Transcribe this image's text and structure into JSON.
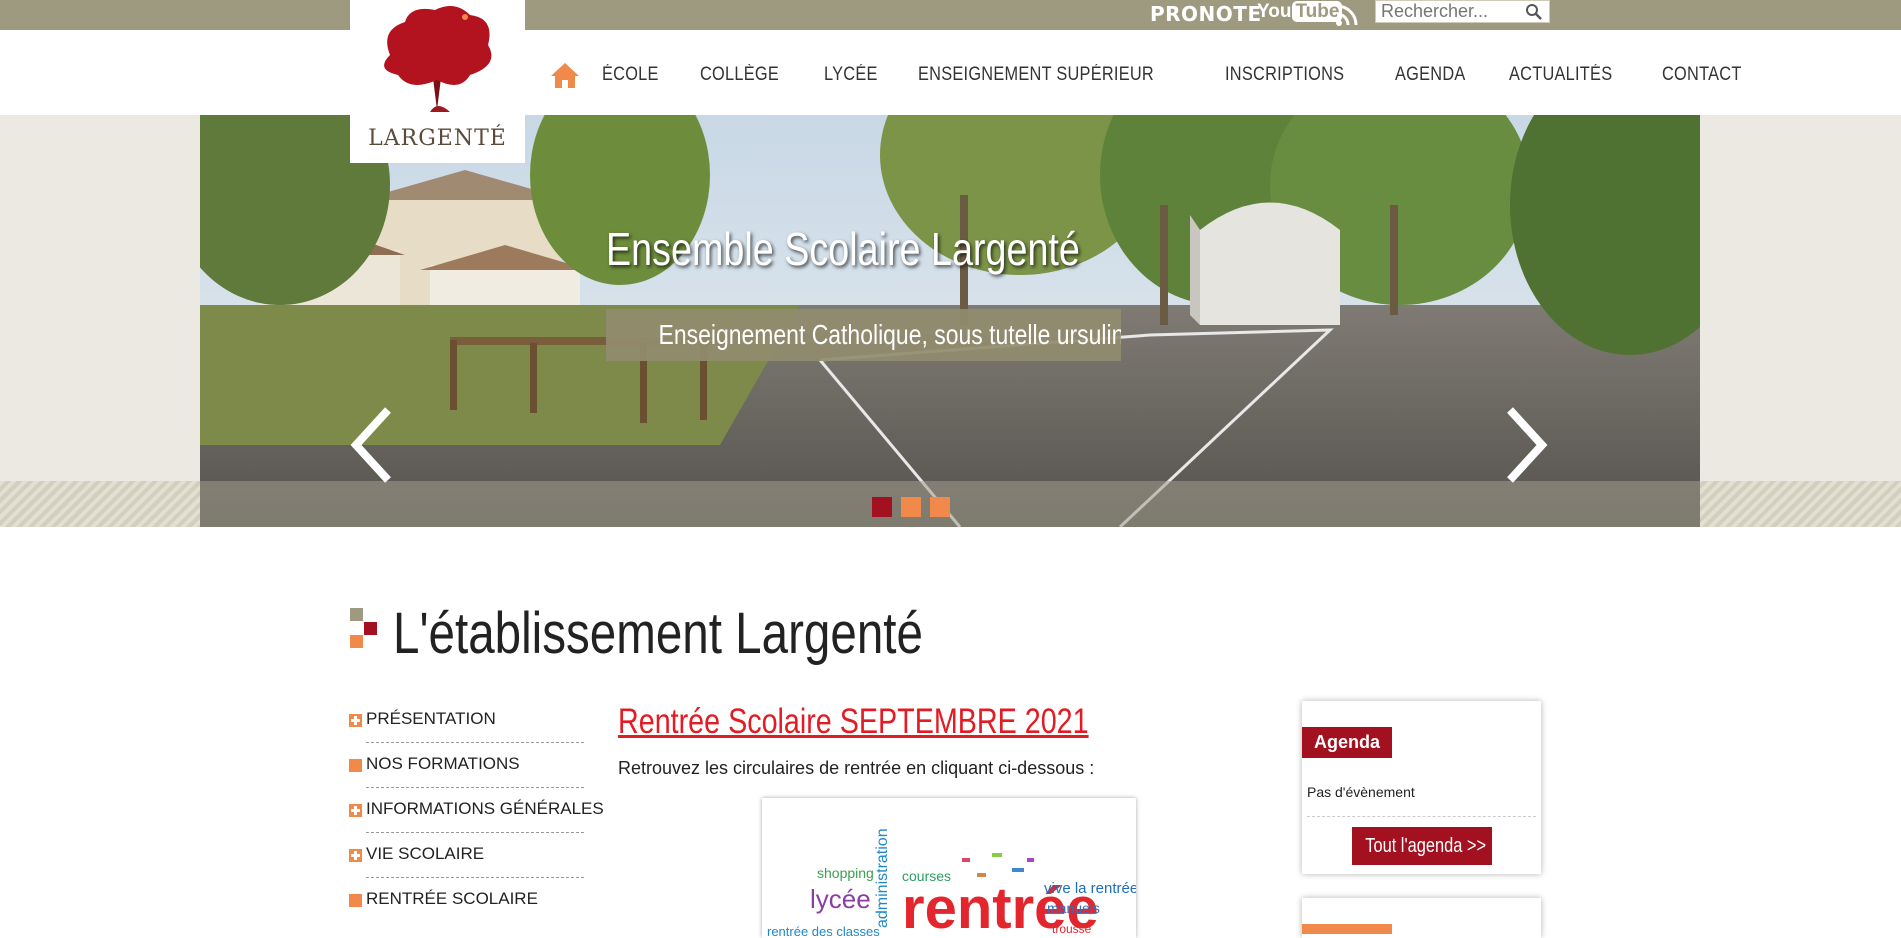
{
  "topbar": {
    "pronote_label": "PRONOTE",
    "youtube_label_you": "You",
    "youtube_label_tube": "Tube",
    "search_placeholder": "Rechercher..."
  },
  "logo": {
    "brand": "LARGENTÉ"
  },
  "menu": {
    "items": [
      {
        "label": "ÉCOLE"
      },
      {
        "label": "COLLÈGE"
      },
      {
        "label": "LYCÉE"
      },
      {
        "label": "ENSEIGNEMENT SUPÉRIEUR"
      },
      {
        "label": "INSCRIPTIONS"
      },
      {
        "label": "AGENDA"
      },
      {
        "label": "ACTUALITÉS"
      },
      {
        "label": "CONTACT"
      }
    ]
  },
  "slider": {
    "title": "Ensemble Scolaire Largenté",
    "subtitle": "Enseignement Catholique, sous tutelle ursuline",
    "slide_count": 3,
    "active_slide": 1
  },
  "section": {
    "title": "L'établissement Largenté"
  },
  "sidebar": {
    "items": [
      {
        "label": "PRÉSENTATION",
        "icon": "plus-icon"
      },
      {
        "label": "NOS FORMATIONS",
        "icon": "square-icon"
      },
      {
        "label": "INFORMATIONS GÉNÉRALES",
        "icon": "plus-icon"
      },
      {
        "label": "VIE SCOLAIRE",
        "icon": "plus-icon"
      },
      {
        "label": "RENTRÉE SCOLAIRE",
        "icon": "square-icon"
      }
    ]
  },
  "article": {
    "title": "Rentrée Scolaire SEPTEMBRE 2021",
    "text": "Retrouvez les circulaires de rentrée en cliquant ci-dessous :",
    "image_words": [
      "rentrée",
      "lycée",
      "administration",
      "courses",
      "shopping",
      "vive la rentrée",
      "manuels",
      "trousse",
      "rentrée des classes"
    ]
  },
  "agenda": {
    "tag": "Agenda",
    "empty_text": "Pas d'évènement",
    "button": "Tout l'agenda >>"
  },
  "colors": {
    "topbar": "#9e9a80",
    "accent_red": "#a3101f",
    "accent_orange": "#f0894a",
    "link_red": "#e31b23"
  }
}
